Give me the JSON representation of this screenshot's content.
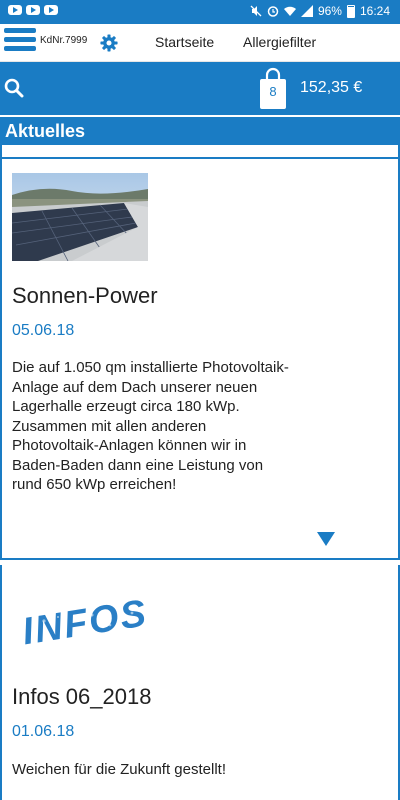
{
  "status": {
    "battery": "96%",
    "time": "16:24"
  },
  "nav": {
    "customer_number": "KdNr.7999",
    "links": [
      "Startseite",
      "Allergiefilter"
    ]
  },
  "cart": {
    "count": "8",
    "total": "152,35 €"
  },
  "section": {
    "title": "Aktuelles"
  },
  "news": [
    {
      "title": "Sonnen-Power",
      "date": "05.06.18",
      "text": "Die auf 1.050 qm installierte Photovoltaik-Anlage auf dem Dach unserer neuen Lagerhalle erzeugt circa 180 kWp. Zusammen mit allen anderen Photovoltaik-Anlagen können wir in Baden-Baden dann eine Leistung von rund 650 kWp erreichen!"
    },
    {
      "title": "Infos 06_2018",
      "logo_text": "INFOS",
      "date": "01.06.18",
      "text": "Weichen für die Zukunft gestellt!"
    }
  ],
  "colors": {
    "brand": "#1a7cc4",
    "text": "#222222"
  }
}
